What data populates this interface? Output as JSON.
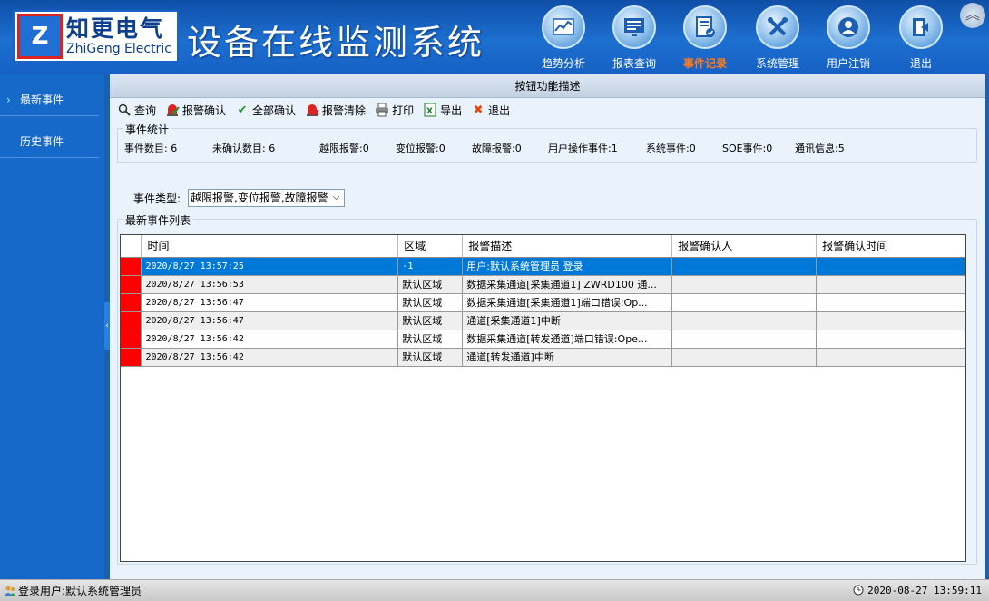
{
  "app": {
    "logo_mark": "Z",
    "logo_cn": "知更电气",
    "logo_en": "ZhiGeng Electric",
    "title": "设备在线监测系统"
  },
  "nav": [
    {
      "label": "趋势分析",
      "icon": "trend-chart-icon",
      "active": false
    },
    {
      "label": "报表查询",
      "icon": "report-monitor-icon",
      "active": false
    },
    {
      "label": "事件记录",
      "icon": "event-record-icon",
      "active": true
    },
    {
      "label": "系统管理",
      "icon": "tools-icon",
      "active": false
    },
    {
      "label": "用户注销",
      "icon": "user-icon",
      "active": false
    },
    {
      "label": "退出",
      "icon": "exit-door-icon",
      "active": false
    }
  ],
  "sidebar": {
    "items": [
      {
        "label": "最新事件",
        "active": true
      },
      {
        "label": "历史事件",
        "active": false
      }
    ]
  },
  "panel": {
    "title": "按钮功能描述"
  },
  "toolbar": {
    "query": "查询",
    "confirm": "报警确认",
    "confirm_all": "全部确认",
    "clear": "报警清除",
    "print": "打印",
    "export": "导出",
    "exit": "退出"
  },
  "stats": {
    "legend": "事件统计",
    "items": [
      "事件数目:   6",
      "未确认数目:   6",
      "越限报警:0",
      "变位报警:0",
      "故障报警:0",
      "用户操作事件:1",
      "系统事件:0",
      "SOE事件:0",
      "通讯信息:5"
    ]
  },
  "filter": {
    "label": "事件类型:",
    "value": "越限报警,变位报警,故障报警"
  },
  "list": {
    "legend": "最新事件列表",
    "columns": [
      "时间",
      "区域",
      "报警描述",
      "报警确认人",
      "报警确认时间"
    ],
    "rows": [
      {
        "time": "2020/8/27 13:57:25",
        "area": "-1",
        "desc": "用户:默认系统管理员 登录",
        "confirmer": "",
        "confirm_time": "",
        "selected": true
      },
      {
        "time": "2020/8/27 13:56:53",
        "area": "默认区域",
        "desc": "数据采集通道[采集通道1] ZWRD100 通...",
        "confirmer": "",
        "confirm_time": ""
      },
      {
        "time": "2020/8/27 13:56:47",
        "area": "默认区域",
        "desc": "数据采集通道[采集通道1]端口错误:Op...",
        "confirmer": "",
        "confirm_time": ""
      },
      {
        "time": "2020/8/27 13:56:47",
        "area": "默认区域",
        "desc": "通道[采集通道1]中断",
        "confirmer": "",
        "confirm_time": ""
      },
      {
        "time": "2020/8/27 13:56:42",
        "area": "默认区域",
        "desc": "数据采集通道[转发通道]端口错误:Ope...",
        "confirmer": "",
        "confirm_time": ""
      },
      {
        "time": "2020/8/27 13:56:42",
        "area": "默认区域",
        "desc": "通道[转发通道]中断",
        "confirmer": "",
        "confirm_time": ""
      }
    ]
  },
  "status": {
    "user": "登录用户:默认系统管理员",
    "datetime": "2020-08-27  13:59:11"
  },
  "colors": {
    "accent": "#1769c9",
    "active_nav": "#ff7a1a",
    "selected_row": "#0078d7",
    "alarm_flag": "#ff0000"
  }
}
